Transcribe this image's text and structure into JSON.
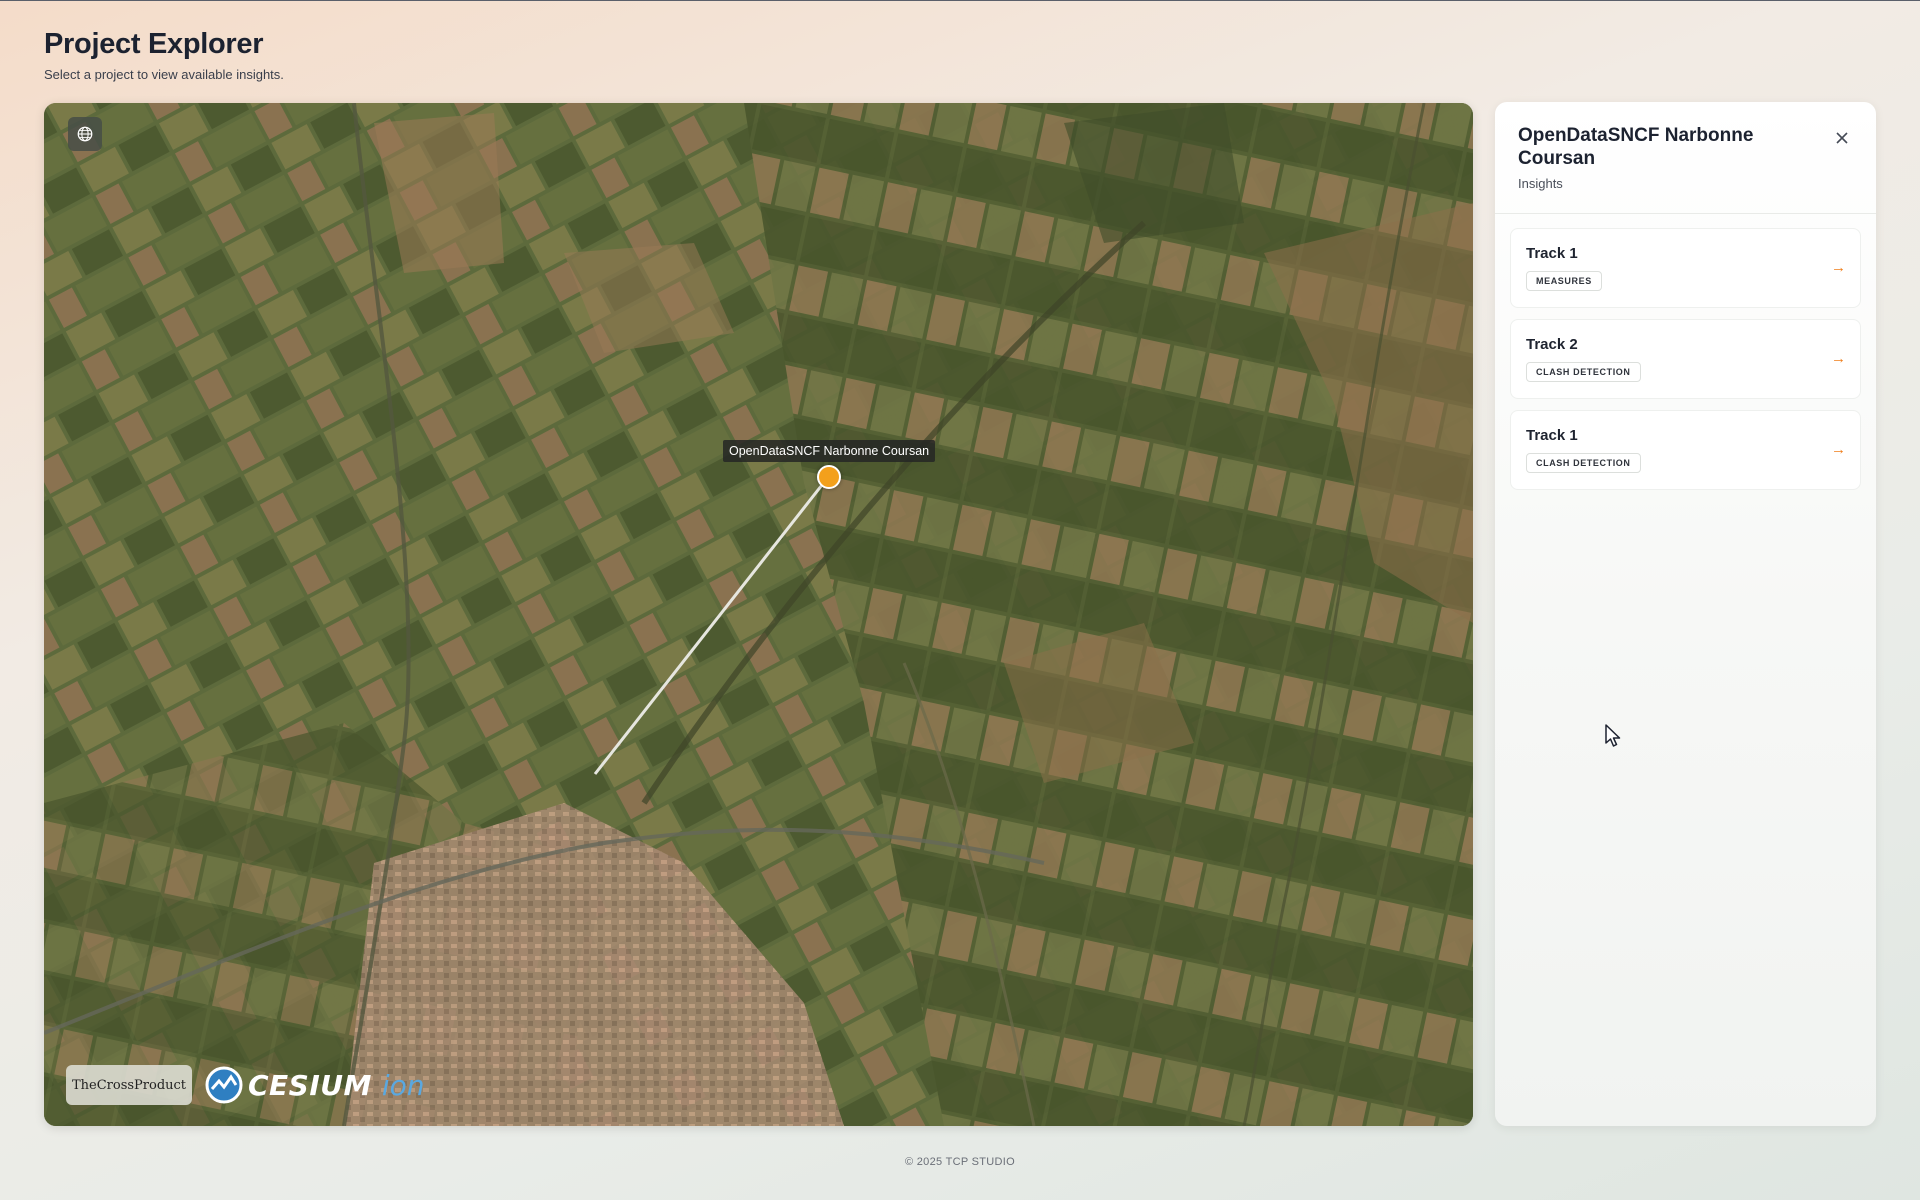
{
  "page": {
    "title": "Project Explorer",
    "subtitle": "Select a project to view available insights."
  },
  "map": {
    "marker_label": "OpenDataSNCF Narbonne Coursan",
    "marker_color": "#f3a01c",
    "globe_icon": "globe-icon",
    "logos": {
      "tcp": "TheCrossProduct",
      "cesium_word": "CESIUM",
      "cesium_ion": "ion"
    }
  },
  "panel": {
    "title": "OpenDataSNCF Narbonne Coursan",
    "subtitle": "Insights",
    "close_icon": "close-icon",
    "insights": [
      {
        "title": "Track 1",
        "tag": "MEASURES",
        "arrow": "→"
      },
      {
        "title": "Track 2",
        "tag": "CLASH DETECTION",
        "arrow": "→"
      },
      {
        "title": "Track 1",
        "tag": "CLASH DETECTION",
        "arrow": "→"
      }
    ],
    "accent": "#ef7d1a"
  },
  "footer": {
    "text": "© 2025 TCP STUDIO"
  }
}
